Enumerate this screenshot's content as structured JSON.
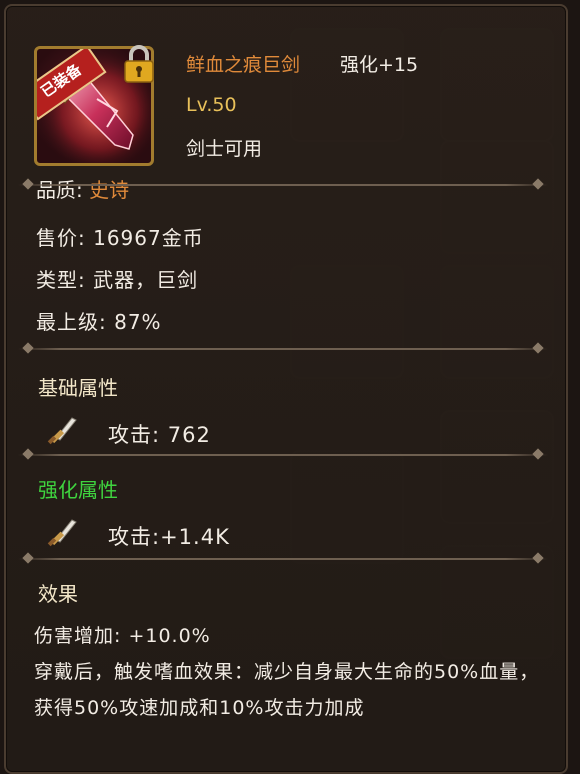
{
  "item": {
    "badge": "已装备",
    "name": "鲜血之痕巨剑",
    "enhance": "强化+15",
    "level": "Lv.50",
    "class_requirement": "剑士可用"
  },
  "info": {
    "quality_label": "品质:",
    "quality_value": "史诗",
    "price": "售价: 16967金币",
    "type": "类型: 武器，巨剑",
    "top_grade": "最上级: 87%"
  },
  "base_stats": {
    "title": "基础属性",
    "attack": "攻击: 762"
  },
  "enhance_stats": {
    "title": "强化属性",
    "attack": "攻击:+1.4K"
  },
  "effects": {
    "title": "效果",
    "line1": "伤害增加: +10.0%",
    "line2": "穿戴后，触发嗜血效果：减少自身最大生命的50%血量，获得50%攻速加成和10%攻击力加成"
  },
  "icons": {
    "lock": "lock-icon",
    "stat": "sword-icon"
  },
  "colors": {
    "item_name": "#e08a3a",
    "level": "#e8c05a",
    "enhance_title": "#3fd33f",
    "frame": "#a27c2e"
  }
}
